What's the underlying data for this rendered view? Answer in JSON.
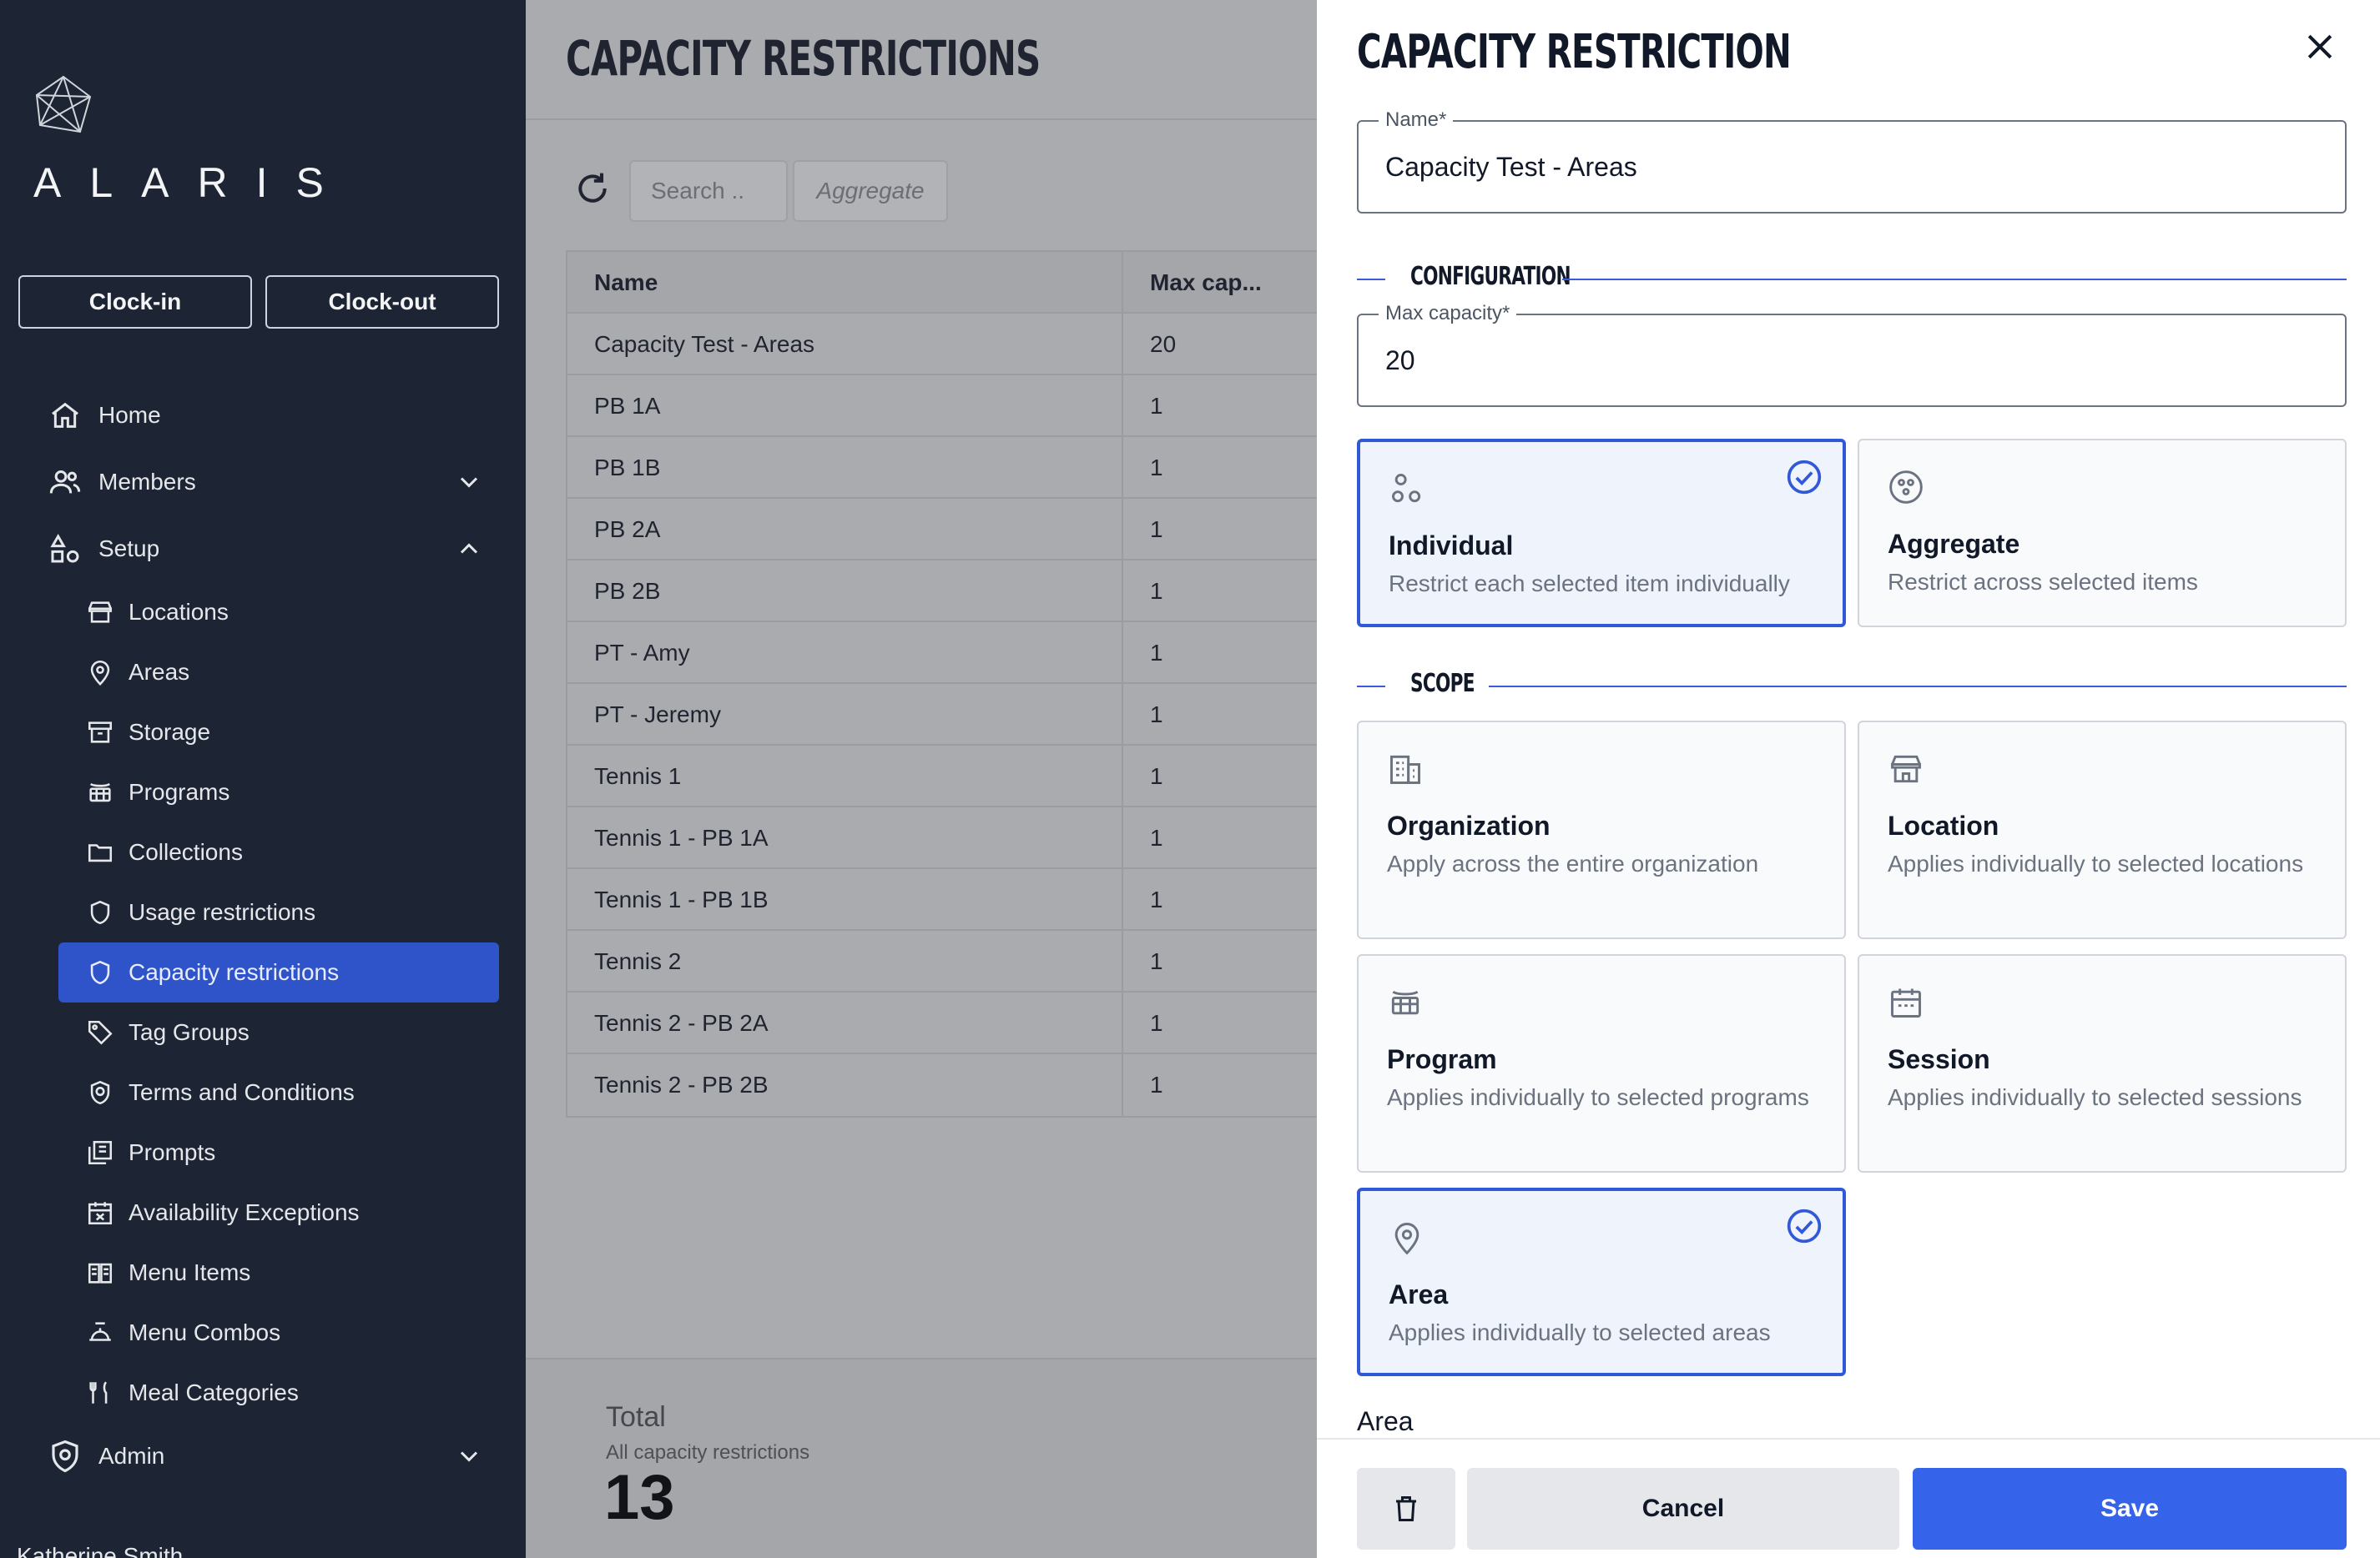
{
  "sidebar": {
    "logo_text": "ALARIS",
    "clock_in": "Clock-in",
    "clock_out": "Clock-out",
    "nav": {
      "home": "Home",
      "members": "Members",
      "setup": "Setup",
      "admin": "Admin"
    },
    "setup_items": [
      {
        "label": "Locations",
        "icon": "storefront-icon"
      },
      {
        "label": "Areas",
        "icon": "map-pin-icon"
      },
      {
        "label": "Storage",
        "icon": "archive-icon"
      },
      {
        "label": "Programs",
        "icon": "program-icon"
      },
      {
        "label": "Collections",
        "icon": "folder-icon"
      },
      {
        "label": "Usage restrictions",
        "icon": "shield-icon"
      },
      {
        "label": "Capacity restrictions",
        "icon": "shield-icon",
        "active": true
      },
      {
        "label": "Tag Groups",
        "icon": "tag-icon"
      },
      {
        "label": "Terms and Conditions",
        "icon": "shield-check-icon"
      },
      {
        "label": "Prompts",
        "icon": "prompts-icon"
      },
      {
        "label": "Availability Exceptions",
        "icon": "calendar-x-icon"
      },
      {
        "label": "Menu Items",
        "icon": "book-icon"
      },
      {
        "label": "Menu Combos",
        "icon": "food-tray-icon"
      },
      {
        "label": "Meal Categories",
        "icon": "fork-knife-icon"
      }
    ],
    "user_name": "Katherine Smith"
  },
  "main": {
    "title": "CAPACITY RESTRICTIONS",
    "search_placeholder": "Search ..",
    "aggregate_chip": "Aggregate",
    "table": {
      "columns": [
        "Name",
        "Max cap..."
      ],
      "rows": [
        [
          "Capacity Test - Areas",
          "20"
        ],
        [
          "PB 1A",
          "1"
        ],
        [
          "PB 1B",
          "1"
        ],
        [
          "PB 2A",
          "1"
        ],
        [
          "PB 2B",
          "1"
        ],
        [
          "PT - Amy",
          "1"
        ],
        [
          "PT - Jeremy",
          "1"
        ],
        [
          "Tennis 1",
          "1"
        ],
        [
          "Tennis 1 - PB 1A",
          "1"
        ],
        [
          "Tennis 1 - PB 1B",
          "1"
        ],
        [
          "Tennis 2",
          "1"
        ],
        [
          "Tennis 2 - PB 2A",
          "1"
        ],
        [
          "Tennis 2 - PB 2B",
          "1"
        ]
      ]
    },
    "total_label": "Total",
    "total_sub": "All capacity restrictions",
    "total_value": "13"
  },
  "panel": {
    "title": "CAPACITY RESTRICTION",
    "name_label": "Name*",
    "name_value": "Capacity Test - Areas",
    "configuration_heading": "CONFIGURATION",
    "max_capacity_label": "Max capacity*",
    "max_capacity_value": "20",
    "modes": [
      {
        "title": "Individual",
        "desc": "Restrict each selected item individually",
        "selected": true
      },
      {
        "title": "Aggregate",
        "desc": "Restrict across selected items",
        "selected": false
      }
    ],
    "scope_heading": "SCOPE",
    "scopes": [
      {
        "title": "Organization",
        "desc": "Apply across the entire organization",
        "selected": false
      },
      {
        "title": "Location",
        "desc": "Applies individually to selected locations",
        "selected": false
      },
      {
        "title": "Program",
        "desc": "Applies individually to selected programs",
        "selected": false
      },
      {
        "title": "Session",
        "desc": "Applies individually to selected sessions",
        "selected": false
      },
      {
        "title": "Area",
        "desc": "Applies individually to selected areas",
        "selected": true
      }
    ],
    "area_label": "Area",
    "cancel": "Cancel",
    "save": "Save"
  },
  "colors": {
    "sidebar_bg": "#1d2433",
    "active_nav": "#2f54c9",
    "primary": "#3563e9",
    "selected_border": "#3158d6"
  }
}
